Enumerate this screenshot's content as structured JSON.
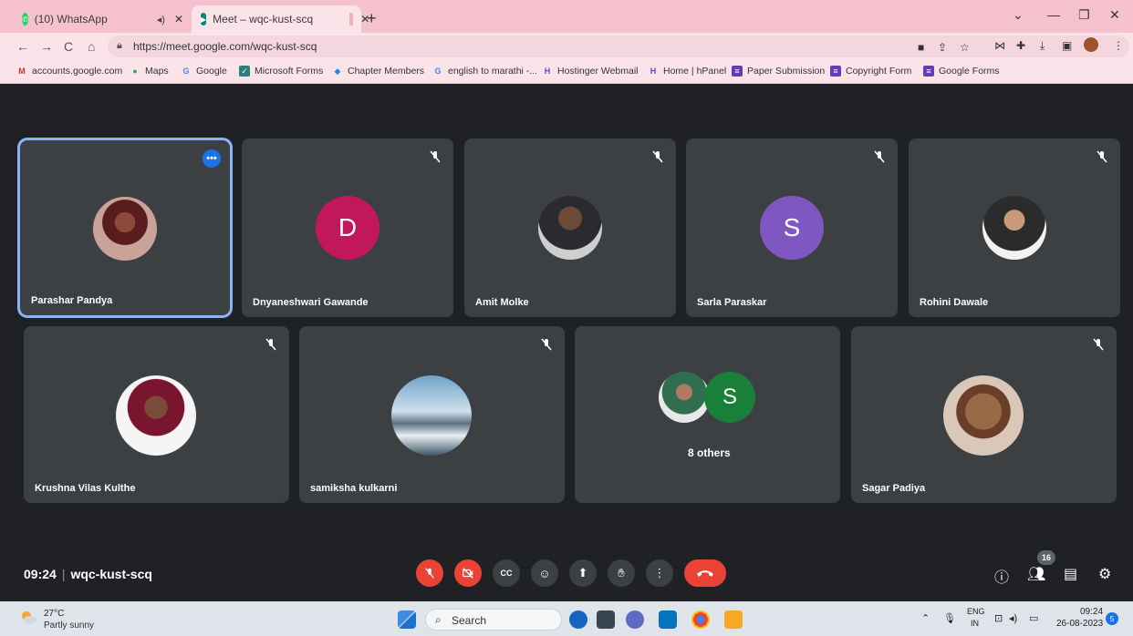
{
  "browser": {
    "tabs": [
      {
        "label": "(10) WhatsApp",
        "favicon": "whatsapp-icon",
        "color": "#25d366"
      },
      {
        "label": "Meet – wqc-kust-scq",
        "favicon": "meet-icon",
        "color": "#00897b"
      }
    ],
    "url": "https://meet.google.com/wqc-kust-scq",
    "bookmarks": [
      "accounts.google.com",
      "Maps",
      "Google",
      "Microsoft Forms",
      "Chapter Members",
      "english to marathi -...",
      "Hostinger Webmail",
      "Home | hPanel",
      "Paper Submission",
      "Copyright Form",
      "Google Forms"
    ]
  },
  "meet": {
    "participants_row1": [
      {
        "name": "Parashar Pandya",
        "type": "photo"
      },
      {
        "name": "Dnyaneshwari Gawande",
        "initial": "D",
        "color": "#c2185b"
      },
      {
        "name": "Amit Molke",
        "type": "photo"
      },
      {
        "name": "Sarla Paraskar",
        "initial": "S",
        "color": "#7e57c2"
      },
      {
        "name": "Rohini Dawale",
        "type": "photo"
      }
    ],
    "participants_row2": [
      {
        "name": "Krushna Vilas Kulthe",
        "type": "photo"
      },
      {
        "name": "samiksha kulkarni",
        "type": "photo"
      },
      {
        "name": "",
        "others_label": "8 others",
        "initial": "S",
        "color": "#188038"
      },
      {
        "name": "Sagar Padiya",
        "type": "photo"
      }
    ],
    "time": "09:24",
    "meeting_code": "wqc-kust-scq",
    "participant_count": "16"
  },
  "taskbar": {
    "temp": "27°C",
    "weather": "Partly sunny",
    "search_placeholder": "Search",
    "lang_top": "ENG",
    "lang_bottom": "IN",
    "time": "09:24",
    "date": "26-08-2023",
    "notification_count": "5"
  },
  "colors": {
    "chrome_tab_bg": "#f6c1cf",
    "meet_bg": "#202124",
    "tile_bg": "#3c4043",
    "active_border": "#8ab4f8",
    "leave_red": "#ea4335"
  }
}
